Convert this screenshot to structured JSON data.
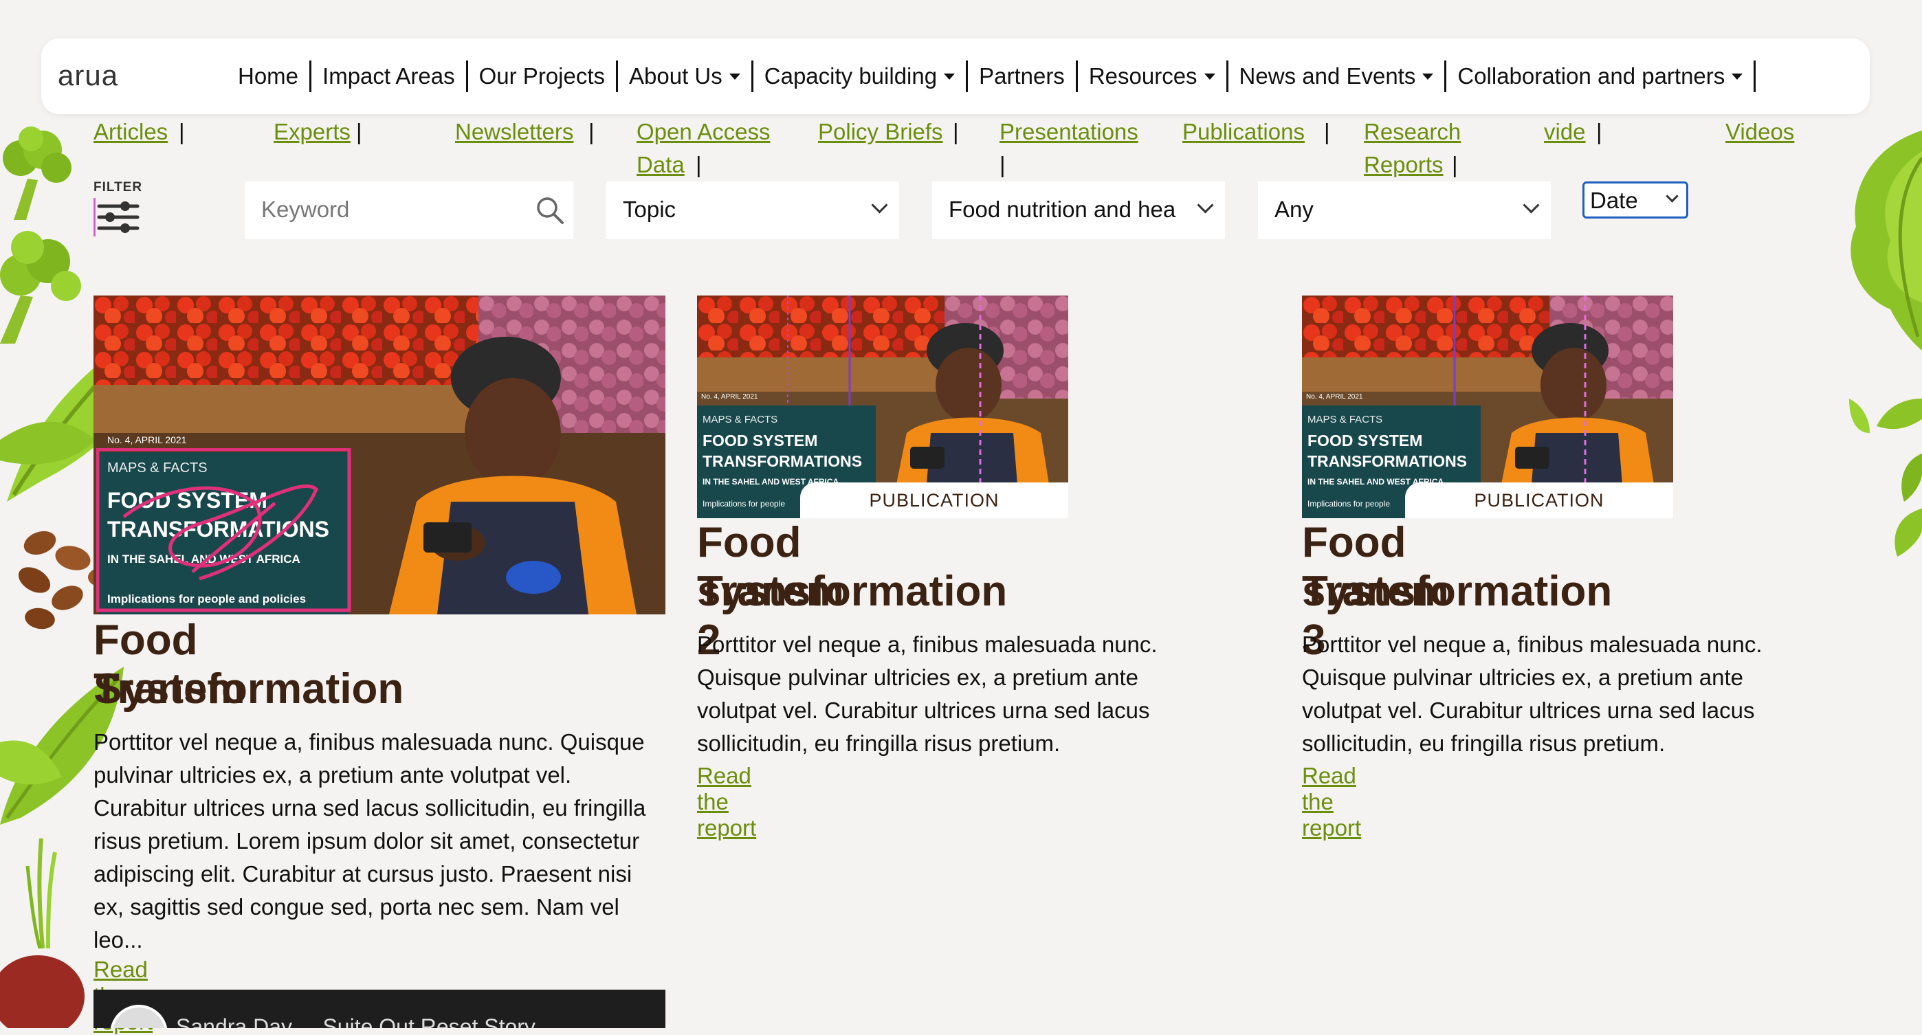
{
  "brand": "arua",
  "nav": {
    "items": [
      {
        "label": "Home",
        "dropdown": false
      },
      {
        "label": "Impact Areas",
        "dropdown": false
      },
      {
        "label": "Our Projects",
        "dropdown": false
      },
      {
        "label": "About Us",
        "dropdown": true
      },
      {
        "label": "Capacity building",
        "dropdown": true
      },
      {
        "label": "Partners",
        "dropdown": false
      },
      {
        "label": "Resources",
        "dropdown": true
      },
      {
        "label": "News and Events",
        "dropdown": true
      },
      {
        "label": "Collaboration and partners",
        "dropdown": true
      }
    ]
  },
  "types": {
    "articles": "Articles",
    "experts": "Experts",
    "newsletters": "Newsletters",
    "open_access_1": "Open Access",
    "open_access_2": "Data",
    "policy_briefs": "Policy Briefs",
    "presentations": "Presentations",
    "publications": "Publications",
    "research_1": "Research",
    "research_2": "Reports",
    "vide": "vide",
    "videos": "Videos",
    "pipe": "|"
  },
  "filters": {
    "label": "FILTER",
    "keyword_placeholder": "Keyword",
    "topic": "Topic",
    "impact_area": "Food nutrition and hea",
    "any": "Any",
    "sort": "Date"
  },
  "cards": [
    {
      "title_line1": "Food System",
      "title_line2": "Transformation",
      "cover_kicker": "No. 4, APRIL 2021",
      "cover_series": "MAPS & FACTS",
      "cover_title_1": "FOOD SYSTEM",
      "cover_title_2": "TRANSFORMATIONS",
      "cover_sub": "IN THE SAHEL AND WEST AFRICA",
      "cover_foot": "Implications for people and policies",
      "desc": "Porttitor vel neque a, finibus malesuada nunc. Quisque pulvinar ultricies ex, a pretium ante volutpat vel. Curabitur ultrices urna sed lacus sollicitudin, eu fringilla risus pretium. Lorem ipsum dolor sit amet, consectetur adipiscing elit. Curabitur at cursus justo. Praesent nisi ex, sagittis sed congue sed, porta nec sem. Nam vel leo...",
      "link": "Read the report"
    },
    {
      "title_line1": "Food system",
      "title_line2": "Transformation 2",
      "cover_kicker": "No. 4, APRIL 2021",
      "cover_series": "MAPS & FACTS",
      "cover_title_1": "FOOD SYSTEM",
      "cover_title_2": "TRANSFORMATIONS",
      "cover_sub": "IN THE SAHEL AND WEST AFRICA",
      "cover_foot": "Implications for people",
      "badge": "PUBLICATION",
      "desc": "Porttitor vel neque a, finibus malesuada nunc. Quisque pulvinar ultricies ex, a pretium ante volutpat vel. Curabitur ultrices urna sed lacus sollicitudin, eu fringilla risus pretium.",
      "link": "Read the report"
    },
    {
      "title_line1": "Food system",
      "title_line2": "Transformation 3",
      "cover_kicker": "No. 4, APRIL 2021",
      "cover_series": "MAPS & FACTS",
      "cover_title_1": "FOOD SYSTEM",
      "cover_title_2": "TRANSFORMATIONS",
      "cover_sub": "IN THE SAHEL AND WEST AFRICA",
      "cover_foot": "Implications for people",
      "badge": "PUBLICATION",
      "desc": "Porttitor vel neque a, finibus malesuada nunc. Quisque pulvinar ultricies ex, a pretium ante volutpat vel. Curabitur ultrices urna sed lacus sollicitudin, eu fringilla risus pretium.",
      "link": "Read the report"
    }
  ],
  "video": {
    "title": "Sandra Day ... Suite Out Reset Story"
  },
  "colors": {
    "accent_green": "#6b8e0d",
    "title_brown": "#3b2212",
    "cover_teal": "#19484c",
    "orange": "#f28b16"
  }
}
